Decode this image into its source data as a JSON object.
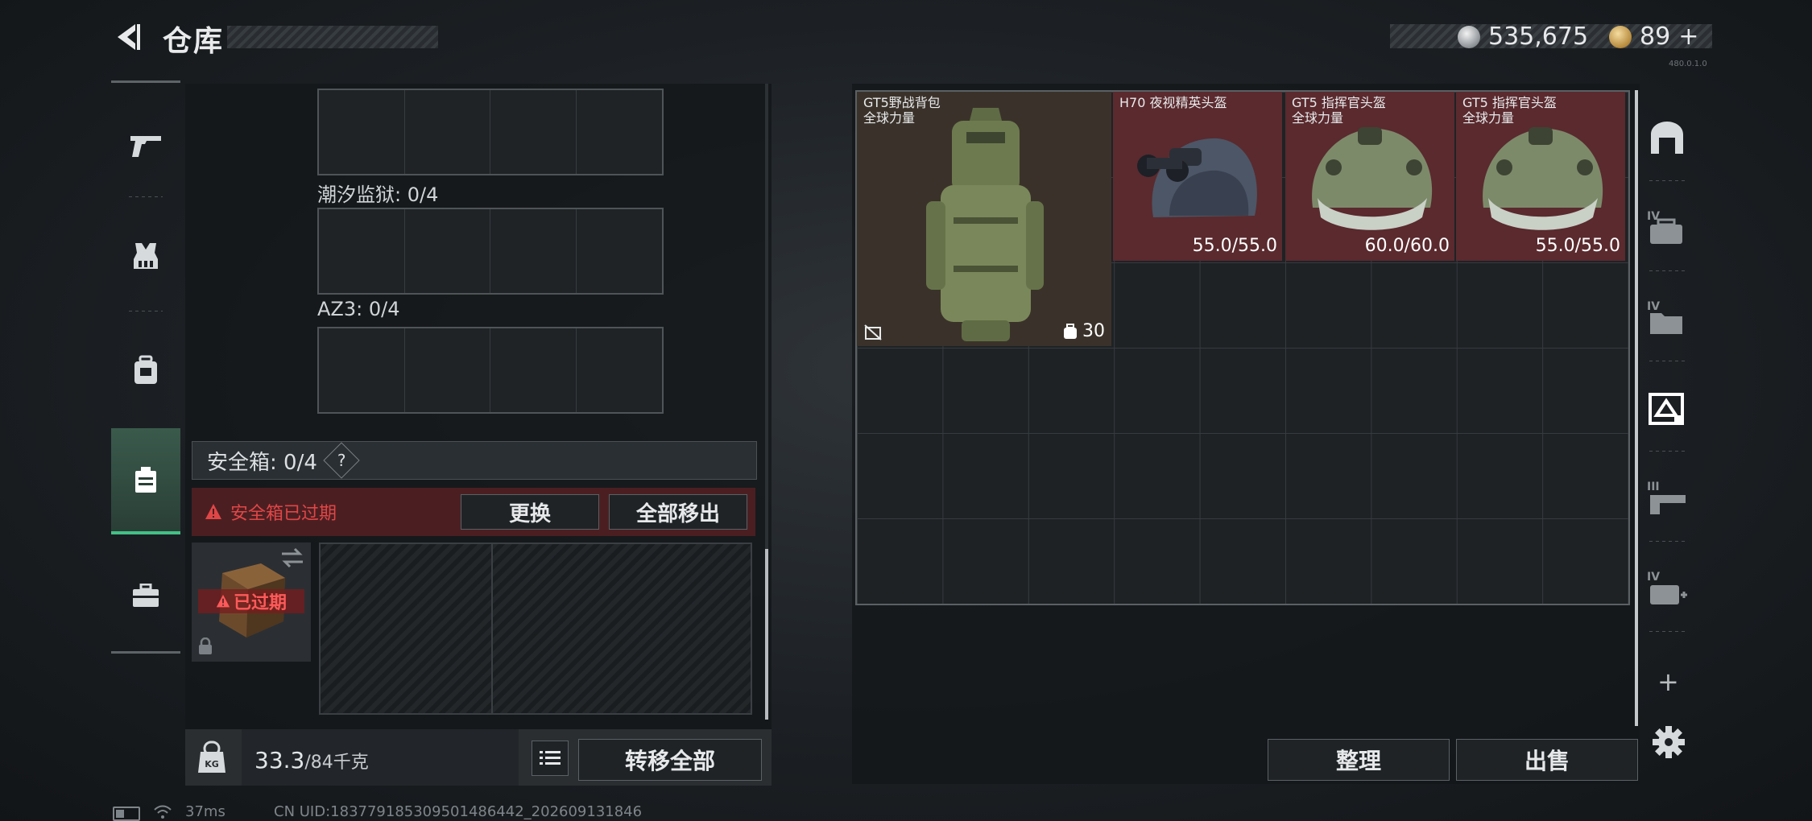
{
  "header": {
    "title": "仓库",
    "currency_silver": "535,675",
    "currency_gold": "89",
    "add_symbol": "+",
    "tiny_text": "480.0.1.0"
  },
  "categories": [
    {
      "name": "weapons",
      "icon": "pistol-icon"
    },
    {
      "name": "armor",
      "icon": "vest-icon"
    },
    {
      "name": "backpack",
      "icon": "backpack-icon"
    },
    {
      "name": "secure-case",
      "icon": "case-icon",
      "active": true
    },
    {
      "name": "toolbox",
      "icon": "toolbox-icon"
    }
  ],
  "left": {
    "slot_labels": [
      "潮汐监狱: 0/4",
      "AZ3: 0/4"
    ],
    "secure_box_label": "安全箱: 0/4",
    "help": "?",
    "expired_warning": "安全箱已过期",
    "replace_button": "更换",
    "move_all_out_button": "全部移出",
    "case_expired_label": "已过期",
    "weight_value": "33.3",
    "weight_unit": "/84千克",
    "transfer_all_button": "转移全部"
  },
  "stash": {
    "items": [
      {
        "name": "GT5野战背包",
        "sub": "全球力量",
        "extra": "30"
      },
      {
        "name": "H70 夜视精英头盔",
        "sub": "",
        "durability": "55.0/55.0"
      },
      {
        "name": "GT5 指挥官头盔",
        "sub": "全球力量",
        "durability": "60.0/60.0"
      },
      {
        "name": "GT5 指挥官头盔",
        "sub": "全球力量",
        "durability": "55.0/55.0"
      }
    ],
    "sort_button": "整理",
    "sell_button": "出售"
  },
  "right_sidebar": {
    "tabs": [
      {
        "icon": "shelter-icon"
      },
      {
        "icon": "tier-iv-weapon-case-icon",
        "tier": "IV"
      },
      {
        "icon": "tier-iv-folder-icon",
        "tier": "IV"
      },
      {
        "icon": "tier-crate-icon"
      },
      {
        "icon": "tier-iii-gun-case-icon",
        "tier": "III"
      },
      {
        "icon": "tier-iv-medkit-icon",
        "tier": "IV"
      }
    ],
    "add": "+"
  },
  "status_bar": {
    "ping": "37ms",
    "uid": "CN UID:18377918530950148644​2_202609131846"
  },
  "colors": {
    "accent_green": "#43c087",
    "warning_red": "#e04646",
    "item_red_bg": "#5a2a2e",
    "item_brown_bg": "#3a322a"
  }
}
